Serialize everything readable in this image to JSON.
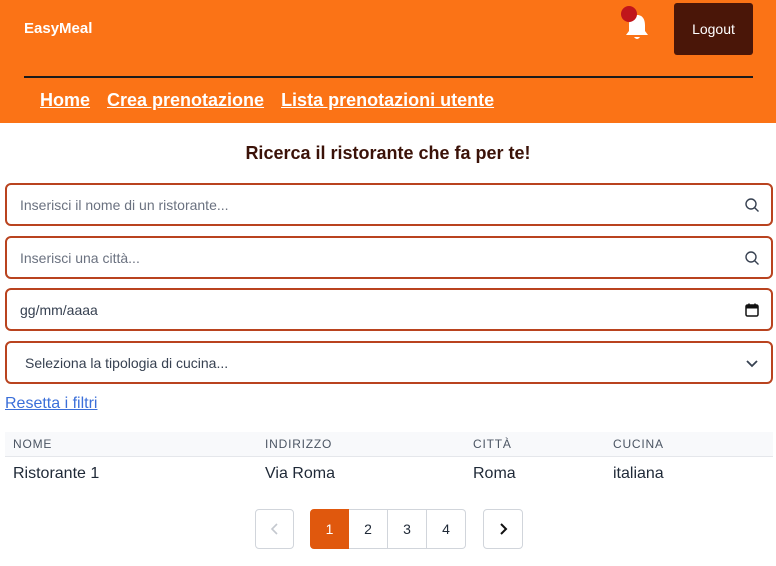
{
  "app": {
    "brand": "EasyMeal"
  },
  "header": {
    "logout_label": "Logout",
    "nav": [
      "Home",
      "Crea prenotazione",
      "Lista prenotazioni utente"
    ]
  },
  "main": {
    "title": "Ricerca il ristorante che fa per te!",
    "filters": {
      "restaurant_placeholder": "Inserisci il nome di un ristorante...",
      "city_placeholder": "Inserisci una città...",
      "date_placeholder": "gg/mm/aaaa",
      "cuisine_selected": "Seleziona la tipologia di cucina..."
    },
    "reset_label": "Resetta i filtri",
    "table": {
      "columns": [
        "NOME",
        "INDIRIZZO",
        "CITTÀ",
        "CUCINA"
      ],
      "rows": [
        [
          "Ristorante 1",
          "Via Roma",
          "Roma",
          "italiana"
        ]
      ]
    },
    "pagination": {
      "pages": [
        "1",
        "2",
        "3",
        "4"
      ],
      "current": "1"
    }
  },
  "colors": {
    "header": "#fb7316",
    "logout": "#4a1608",
    "field_border": "#b9431f",
    "active_page": "#e0580d",
    "link": "#3b6fd9"
  },
  "icons": {
    "notification": "bell-icon",
    "search": "search-icon",
    "calendar": "calendar-icon",
    "select": "chevron-down-icon",
    "prev": "chevron-left-icon",
    "next": "chevron-right-icon"
  }
}
